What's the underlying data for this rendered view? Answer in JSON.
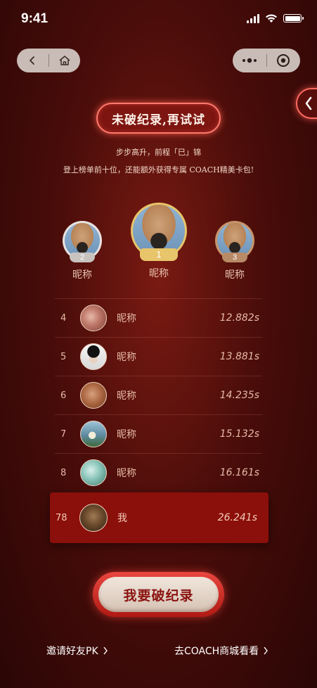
{
  "status": {
    "time": "9:41"
  },
  "banner": {
    "title": "未破纪录,再试试",
    "subtitle1": "步步高升，前程「巳」锦",
    "subtitle2": "登上榜单前十位，还能额外获得专属 COACH精美卡包!"
  },
  "podium": [
    {
      "rank": "2",
      "name": "昵称"
    },
    {
      "rank": "1",
      "name": "昵称"
    },
    {
      "rank": "3",
      "name": "昵称"
    }
  ],
  "leaderboard": [
    {
      "rank": "4",
      "name": "昵称",
      "time": "12.882s"
    },
    {
      "rank": "5",
      "name": "昵称",
      "time": "13.881s"
    },
    {
      "rank": "6",
      "name": "昵称",
      "time": "14.235s"
    },
    {
      "rank": "7",
      "name": "昵称",
      "time": "15.132s"
    },
    {
      "rank": "8",
      "name": "昵称",
      "time": "16.161s"
    }
  ],
  "mine": {
    "rank": "78",
    "name": "我",
    "time": "26.241s"
  },
  "cta": {
    "label": "我要破纪录"
  },
  "links": {
    "invite": "邀请好友PK",
    "shop": "去COACH商城看看"
  },
  "colors": {
    "accent": "#8b0f0a",
    "gold": "#e8c46a",
    "glow": "#ff6b63"
  }
}
